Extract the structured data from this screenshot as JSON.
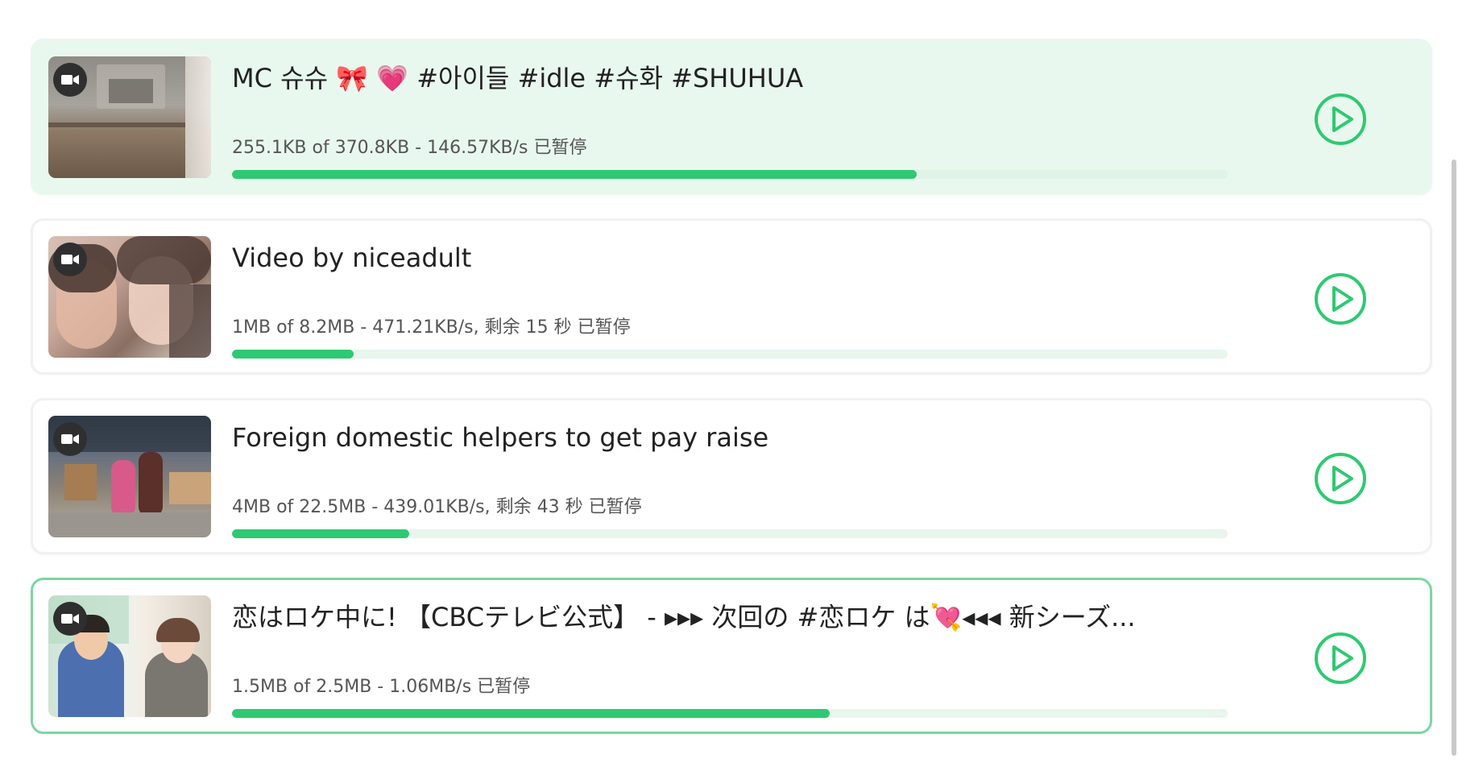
{
  "downloads": [
    {
      "title": "MC 슈슈 🎀 💗 #아이들 #idle #슈화 #SHUHUA",
      "status": "255.1KB of 370.8KB -  146.57KB/s 已暂停",
      "progress": 0.688,
      "thumbnail_icon": "video-camera-icon",
      "action_icon": "play-icon"
    },
    {
      "title": "Video by niceadult",
      "status": "1MB of 8.2MB -  471.21KB/s, 剩余 15 秒 已暂停",
      "progress": 0.122,
      "thumbnail_icon": "video-camera-icon",
      "action_icon": "play-icon"
    },
    {
      "title": "Foreign domestic helpers to get pay raise",
      "status": "4MB of 22.5MB -  439.01KB/s, 剩余 43 秒 已暂停",
      "progress": 0.178,
      "thumbnail_icon": "video-camera-icon",
      "action_icon": "play-icon"
    },
    {
      "title": "恋はロケ中に! 【CBCテレビ公式】 - ▸▸▸ 次回の #恋ロケ は💘◂◂◂ 新シーズ...",
      "status": "1.5MB of 2.5MB -   1.06MB/s 已暂停",
      "progress": 0.6,
      "thumbnail_icon": "video-camera-icon",
      "action_icon": "play-icon"
    }
  ],
  "colors": {
    "accent": "#2ec972",
    "active_background": "#e9f8ee",
    "selected_border": "#7dd6a0"
  }
}
